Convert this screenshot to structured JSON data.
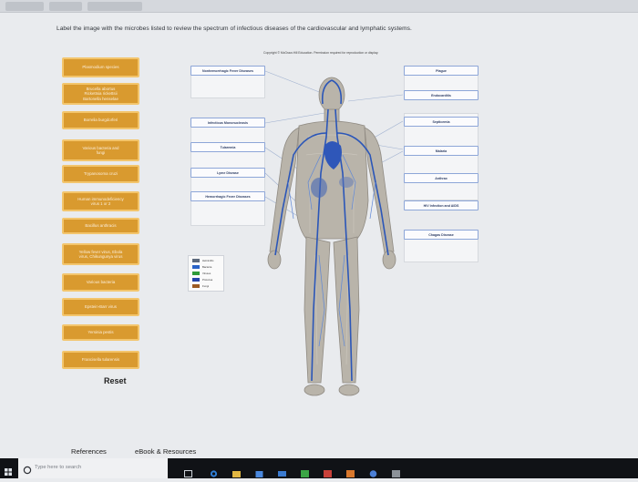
{
  "instruction": "Label the image with the microbes listed to review the spectrum of infectious diseases of the cardiovascular and lymphatic systems.",
  "copyright": "Copyright © McGraw-Hill Education. Permission required for reproduction or display.",
  "labels": [
    "Plasmodium species",
    "Brucella abortus\nRickettsia rickettsii\nBartonella henselae",
    "Borrelia burgdorferi",
    "Various bacteria and\nfungi",
    "Trypanosoma cruzi",
    "Human immunodeficiency\nvirus 1 or 2",
    "Bacillus anthracis",
    "Yellow fever virus, Ebola\nvirus, Chikungunya virus",
    "Various bacteria",
    "Epstein-Barr virus",
    "Yersinia pestis",
    "Francisella tularensis"
  ],
  "left_boxes": [
    "Nonhemorrhagic Fever Diseases",
    "Infectious Mononucleosis",
    "Tularemia",
    "Lyme Disease",
    "Hemorrhagic Fever Diseases"
  ],
  "right_boxes": [
    "Plague",
    "Endocarditis",
    "Septicemia",
    "Malaria",
    "Anthrax",
    "HIV Infection and AIDS",
    "Chagas Disease"
  ],
  "legend": [
    {
      "label": "Helminths",
      "color": "#5d6a7d"
    },
    {
      "label": "Bacteria",
      "color": "#2a63c8"
    },
    {
      "label": "Viruses",
      "color": "#2f9a38"
    },
    {
      "label": "Protozoa",
      "color": "#2544a8"
    },
    {
      "label": "Fungi",
      "color": "#9b5a22"
    }
  ],
  "reset_label": "Reset",
  "references_label": "References",
  "ebook_label": "eBook & Resources",
  "taskbar": {
    "search_placeholder": "Type here to search"
  }
}
